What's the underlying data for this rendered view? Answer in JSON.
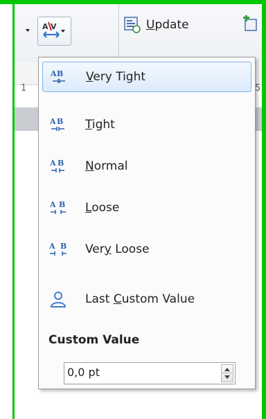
{
  "toolbar": {
    "update_label_first": "U",
    "update_label_rest": "pdate",
    "spacing_button_icon": "character-spacing-icon"
  },
  "ruler": {
    "left_number": "1",
    "right_number": "5"
  },
  "menu": {
    "items": [
      {
        "pre": "",
        "acc": "V",
        "post": "ery Tight",
        "icon": "spacing-very-tight-icon",
        "highlighted": true
      },
      {
        "pre": "",
        "acc": "T",
        "post": "ight",
        "icon": "spacing-tight-icon"
      },
      {
        "pre": "",
        "acc": "N",
        "post": "ormal",
        "icon": "spacing-normal-icon"
      },
      {
        "pre": "",
        "acc": "L",
        "post": "oose",
        "icon": "spacing-loose-icon"
      },
      {
        "pre": "Ver",
        "acc": "y",
        "post": " Loose",
        "icon": "spacing-very-loose-icon"
      },
      {
        "pre": "Last ",
        "acc": "C",
        "post": "ustom Value",
        "icon": "user-icon"
      }
    ],
    "custom_value_title": "Custom Value",
    "custom_value": "0,0 pt"
  },
  "colors": {
    "frame": "#00c800",
    "highlight_border": "#7eb4ea",
    "highlight_fill": "#dcebfb"
  }
}
